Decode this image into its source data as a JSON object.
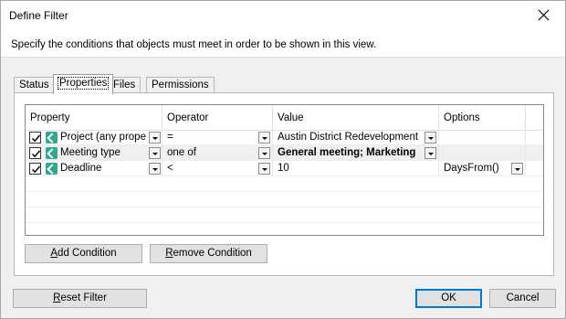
{
  "window": {
    "title": "Define Filter"
  },
  "instruction": "Specify the conditions that objects must meet in order to be shown in this view.",
  "tabs": [
    {
      "label": "Status",
      "active": false
    },
    {
      "label": "Properties",
      "active": true
    },
    {
      "label": "Files",
      "active": false
    },
    {
      "label": "Permissions",
      "active": false
    }
  ],
  "grid": {
    "columns": [
      "Property",
      "Operator",
      "Value",
      "Options"
    ],
    "rows": [
      {
        "checked": true,
        "property": "Project (any proper",
        "operator": "=",
        "value": "Austin District Redevelopment",
        "options": ""
      },
      {
        "checked": true,
        "property": "Meeting type",
        "operator": "one of",
        "value": "General meeting; Marketing",
        "options": ""
      },
      {
        "checked": true,
        "property": "Deadline",
        "operator": "<",
        "value": "10",
        "options": "DaysFrom()"
      }
    ]
  },
  "buttons": {
    "add_condition_hotkey": "A",
    "add_condition_rest": "dd Condition",
    "remove_condition_hotkey": "R",
    "remove_condition_rest": "emove Condition",
    "reset_filter_hotkey": "R",
    "reset_filter_rest": "eset Filter",
    "ok": "OK",
    "cancel": "Cancel"
  },
  "icons": {
    "close": "close-icon",
    "checkbox": "checkmark-icon",
    "property": "property-icon",
    "dropdown": "chevron-down-icon"
  },
  "colors": {
    "accent": "#0078d7",
    "property_icon": "#2ea88f"
  }
}
